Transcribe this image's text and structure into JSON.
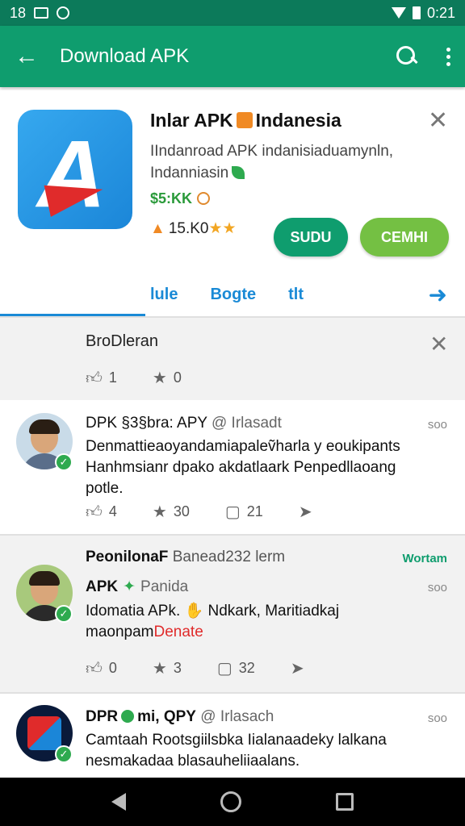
{
  "status_bar": {
    "time_left": "18",
    "time_right": "0:21"
  },
  "app_bar": {
    "title": "Download APK"
  },
  "app": {
    "name_left": "Inlar APK",
    "name_right": "Indanesia",
    "description_line1": "IIndanroad APK indanisiaduamynln,",
    "description_line2": "Indanniasin",
    "price": "$5:KK",
    "rating": "15.K0",
    "stars": "★★",
    "subscribe_label": "SUDU",
    "download_label": "CEMHI",
    "tabs": [
      "lule",
      "Bogte",
      "tlt"
    ]
  },
  "notice": {
    "title": "BroDleran",
    "likes": "1",
    "stars": "0"
  },
  "posts": [
    {
      "author": "DPK §3§bra: APY",
      "handle": "@ Irlasadt",
      "time": "soo",
      "body_line1": "Denmattieaoyandamiapaleṽharla y eoukipants",
      "body_line2": "Hanhmsianr dpako akdatlaark Penpedllaoang",
      "body_line3": "potle.",
      "likes": "4",
      "stars": "30",
      "comments": "21"
    },
    {
      "section_name": "PeonilonaF",
      "section_meta": "Banead232",
      "section_meta2": "lerm",
      "section_tag": "Wortam",
      "author": "APK",
      "handle": "Panida",
      "time": "soo",
      "body_line1_pre": "Idomatia APk.",
      "body_line1_post": "Ndkark, Maritiadkaj",
      "body_line2_pre": "maonpam",
      "body_line2_red": "Denate",
      "likes": "0",
      "stars": "3",
      "comments": "32"
    },
    {
      "author_pre": "DPR",
      "author_post": "mi, QPY",
      "handle": "@ Irlasach",
      "time": "soo",
      "body_line1": "Camtaah Rootsgiilsbka Iialanaadeky lalkana",
      "body_line2": "nesmakadaa blasauheliiaalans."
    }
  ]
}
